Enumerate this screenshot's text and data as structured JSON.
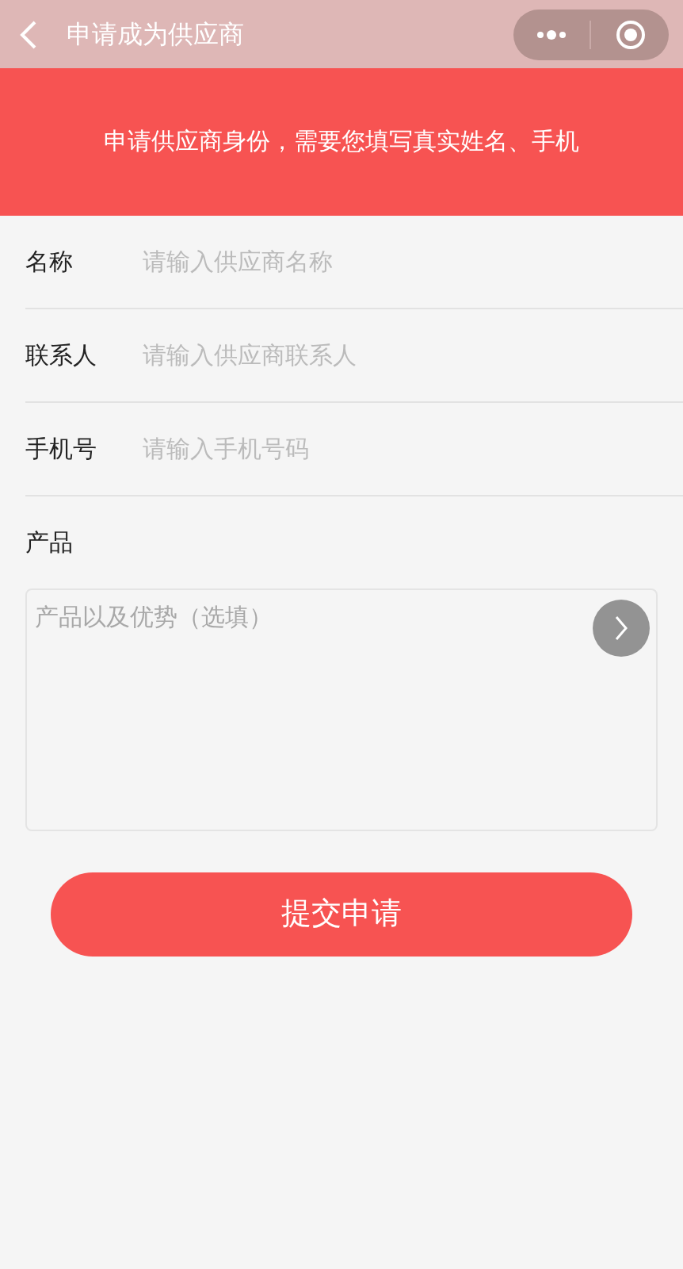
{
  "header": {
    "title": "申请成为供应商"
  },
  "banner": {
    "text": "申请供应商身份，需要您填写真实姓名、手机"
  },
  "fields": [
    {
      "label": "名称",
      "placeholder": "请输入供应商名称"
    },
    {
      "label": "联系人",
      "placeholder": "请输入供应商联系人"
    },
    {
      "label": "手机号",
      "placeholder": "请输入手机号码"
    }
  ],
  "product": {
    "label": "产品",
    "placeholder": "产品以及优势（选填）"
  },
  "submit": "提交申请"
}
